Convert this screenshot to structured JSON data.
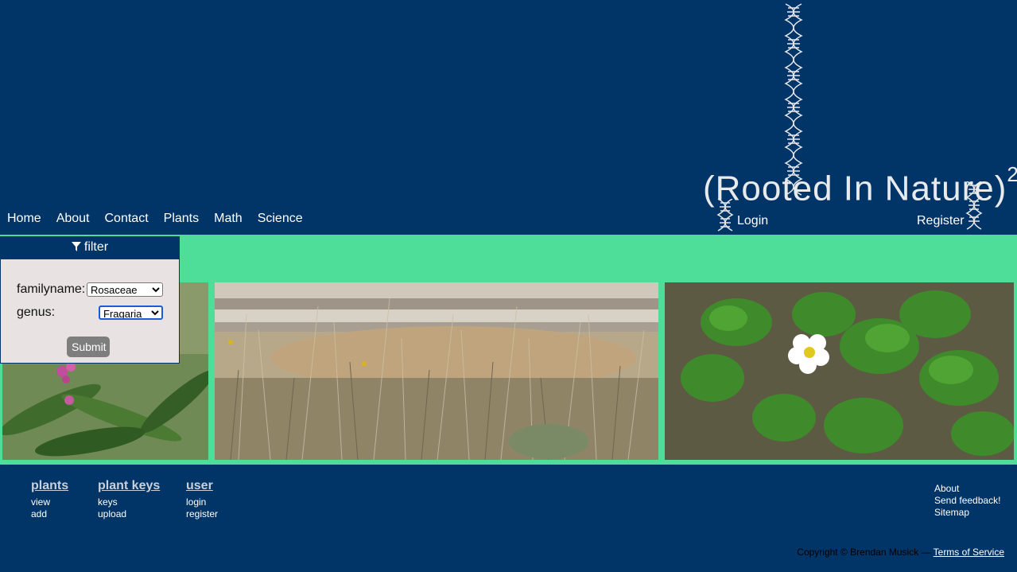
{
  "nav": {
    "items": [
      "Home",
      "About",
      "Contact",
      "Plants",
      "Math",
      "Science"
    ]
  },
  "logo": {
    "text": "(Rooted In Nature)",
    "superscript": "2"
  },
  "auth": {
    "login": "Login",
    "register": "Register"
  },
  "filter": {
    "title": "filter",
    "icon": "filter-icon",
    "familyname_label": "familyname:",
    "familyname_value": "Rosaceae",
    "genus_label": "genus:",
    "genus_value": "Fragaria",
    "submit_label": "Submit"
  },
  "gallery": [
    {
      "subject": "pink flowering plant"
    },
    {
      "subject": "grasses by a pond"
    },
    {
      "subject": "white strawberry flower"
    }
  ],
  "footer": {
    "plants": {
      "title": "plants",
      "links": [
        "view",
        "add"
      ]
    },
    "plant_keys": {
      "title": "plant keys",
      "links": [
        "keys",
        "upload"
      ]
    },
    "user": {
      "title": "user",
      "links": [
        "login",
        "register"
      ]
    },
    "right_links": [
      "About",
      "Send feedback!",
      "Sitemap"
    ],
    "copyright": "Copyright © Brendan Musick — ",
    "terms": "Terms of Service"
  },
  "colors": {
    "navy": "#023567",
    "green": "#4fde9a",
    "panel": "#e9e2e2"
  }
}
